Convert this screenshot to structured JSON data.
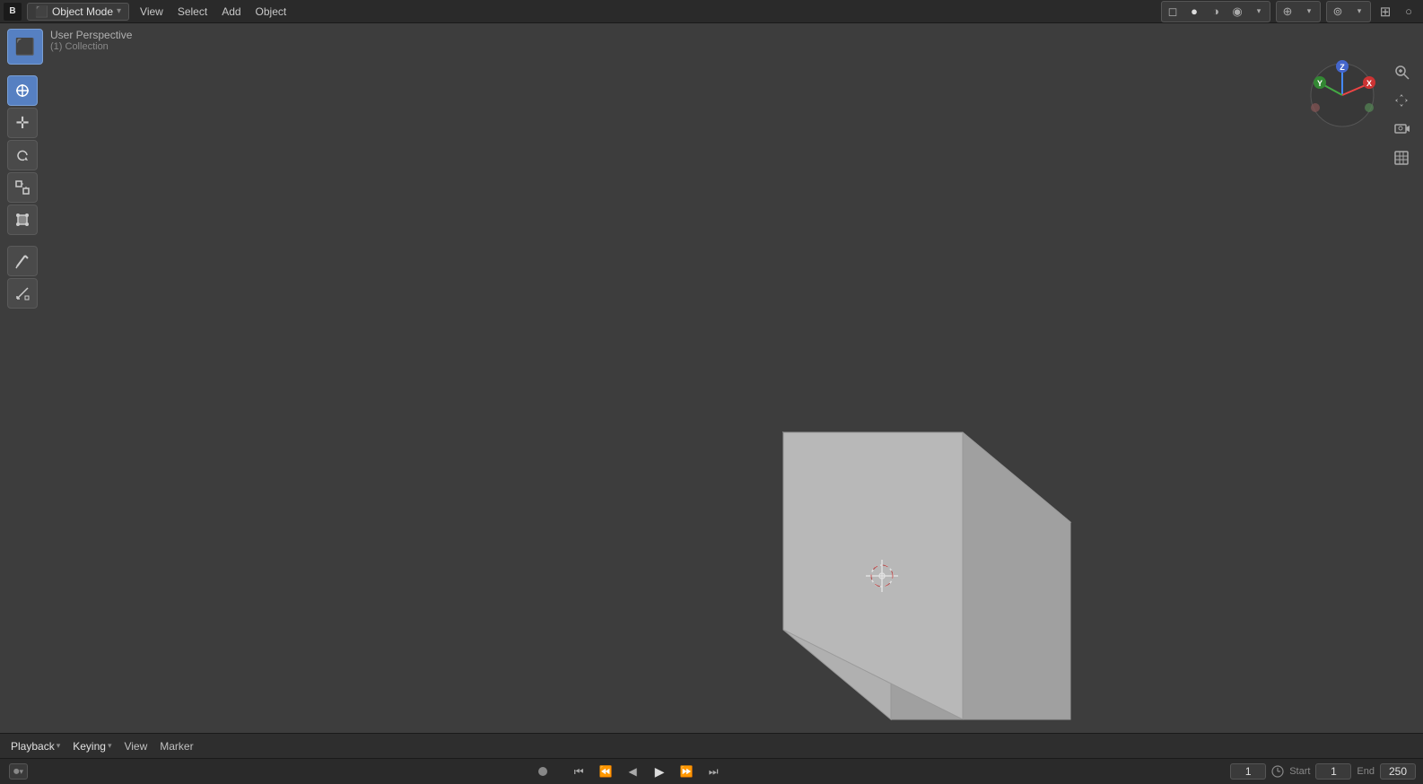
{
  "app": {
    "logo": "B",
    "mode": "Object Mode",
    "mode_chevron": "▾"
  },
  "top_menu": {
    "items": [
      "View",
      "Select",
      "Add",
      "Object"
    ]
  },
  "top_right_icons": [
    {
      "name": "viewport-shading-icon",
      "symbol": "⊙"
    },
    {
      "name": "overlay-icon",
      "symbol": "⊕"
    },
    {
      "name": "gizmo-icon",
      "symbol": "⊚"
    },
    {
      "name": "snap-icon",
      "symbol": "⊞"
    },
    {
      "name": "proportional-icon",
      "symbol": "○"
    },
    {
      "name": "render-icon",
      "symbol": "◉"
    }
  ],
  "viewport": {
    "title": "User Perspective",
    "subtitle": "(1) Collection",
    "mode_icon": "⬛",
    "mode_label": "Object Mode"
  },
  "left_tools": [
    {
      "name": "cursor-tool",
      "icon": "⊕",
      "active": true,
      "label": "Cursor"
    },
    {
      "name": "move-tool",
      "icon": "✛",
      "active": false,
      "label": "Move"
    },
    {
      "name": "rotate-tool",
      "icon": "↻",
      "active": false,
      "label": "Rotate"
    },
    {
      "name": "scale-tool",
      "icon": "⤢",
      "active": false,
      "label": "Scale"
    },
    {
      "name": "transform-tool",
      "icon": "⊡",
      "active": false,
      "label": "Transform"
    },
    {
      "name": "annotate-tool",
      "icon": "✏",
      "active": false,
      "label": "Annotate"
    },
    {
      "name": "measure-tool",
      "icon": "📐",
      "active": false,
      "label": "Measure"
    }
  ],
  "right_tools": [
    {
      "name": "zoom-tool",
      "icon": "🔍",
      "label": "Zoom"
    },
    {
      "name": "pan-tool",
      "icon": "✋",
      "label": "Pan"
    },
    {
      "name": "camera-tool",
      "icon": "🎥",
      "label": "Camera"
    },
    {
      "name": "grid-tool",
      "icon": "⊞",
      "label": "Grid"
    }
  ],
  "axis_gizmo": {
    "x_color": "#e44",
    "y_color": "#4c4",
    "z_color": "#44e",
    "labels": [
      "X",
      "Y",
      "Z"
    ]
  },
  "bottom_bar": {
    "playback_label": "Playback",
    "keying_label": "Keying",
    "view_label": "View",
    "marker_label": "Marker",
    "frame_current": "1",
    "frame_start": "1",
    "frame_end": "250",
    "start_label": "Start",
    "end_label": "End"
  },
  "playback_controls": [
    {
      "name": "jump-start-btn",
      "icon": "⏮",
      "label": "Jump to Start"
    },
    {
      "name": "step-back-btn",
      "icon": "⏪",
      "label": "Step Back"
    },
    {
      "name": "play-back-btn",
      "icon": "◀",
      "label": "Play Back"
    },
    {
      "name": "play-forward-btn",
      "icon": "▶",
      "label": "Play Forward"
    },
    {
      "name": "step-forward-btn",
      "icon": "⏩",
      "label": "Step Forward"
    },
    {
      "name": "jump-end-btn",
      "icon": "⏭",
      "label": "Jump to End"
    }
  ],
  "colors": {
    "background": "#3d3d3d",
    "top_bar": "#2a2a2a",
    "toolbar": "#4a4a4a",
    "cube_face_front": "#b0b0b0",
    "cube_face_top": "#d0d0d0",
    "cube_face_side": "#a0a0a0",
    "grid": "#4a4a4a",
    "accent_blue": "#5680c2",
    "axis_x": "#c04040",
    "axis_y": "#40c040",
    "axis_z": "#4040c0"
  }
}
